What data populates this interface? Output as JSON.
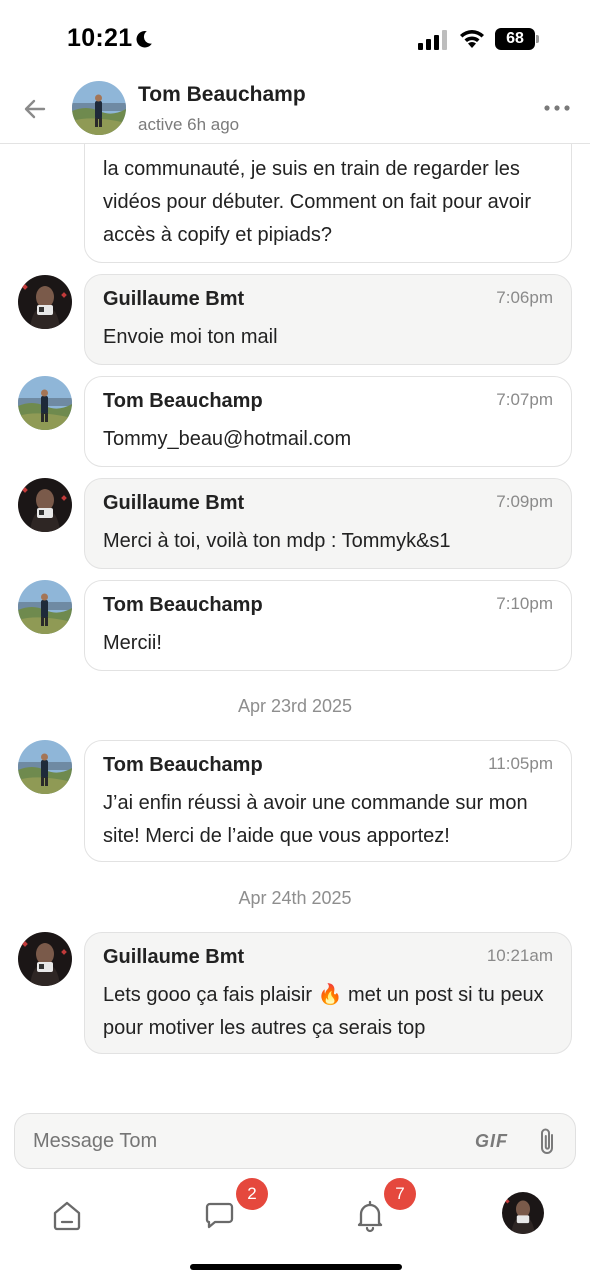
{
  "status_bar": {
    "time": "10:21",
    "battery": "68"
  },
  "header": {
    "name": "Tom Beauchamp",
    "status": "active 6h ago"
  },
  "messages": [
    {
      "sender": "",
      "time": "",
      "text": "la communauté, je suis en train de regarder les vidéos pour débuter. Comment on fait pour avoir accès à copify et pipiads?"
    },
    {
      "sender": "Guillaume Bmt",
      "time": "7:06pm",
      "text": "Envoie moi ton mail"
    },
    {
      "sender": "Tom Beauchamp",
      "time": "7:07pm",
      "text": "Tommy_beau@hotmail.com"
    },
    {
      "sender": "Guillaume Bmt",
      "time": "7:09pm",
      "text": "Merci à toi, voilà ton mdp : Tommyk&s1"
    },
    {
      "sender": "Tom Beauchamp",
      "time": "7:10pm",
      "text": "Mercii!"
    },
    {
      "sender": "Tom Beauchamp",
      "time": "11:05pm",
      "text": "J’ai enfin réussi à avoir une commande sur mon site! Merci de l’aide que vous apportez!"
    },
    {
      "sender": "Guillaume Bmt",
      "time": "10:21am",
      "text": "Lets gooo ça fais plaisir 🔥 met un post si tu peux pour motiver les autres ça serais top"
    }
  ],
  "date_separators": [
    "Apr 23rd 2025",
    "Apr 24th 2025"
  ],
  "composer": {
    "placeholder": "Message Tom",
    "gif_label": "GIF"
  },
  "nav": {
    "messages_badge": "2",
    "notifications_badge": "7"
  },
  "icons": {
    "back": "arrow-left-icon",
    "more": "more-horizontal-icon",
    "attach": "paperclip-icon",
    "home": "home-icon",
    "messages": "chat-bubble-icon",
    "notifications": "bell-icon"
  },
  "colors": {
    "badge": "#e5483d",
    "bubble_grey": "#f5f5f4",
    "border": "#e2e2e2"
  }
}
